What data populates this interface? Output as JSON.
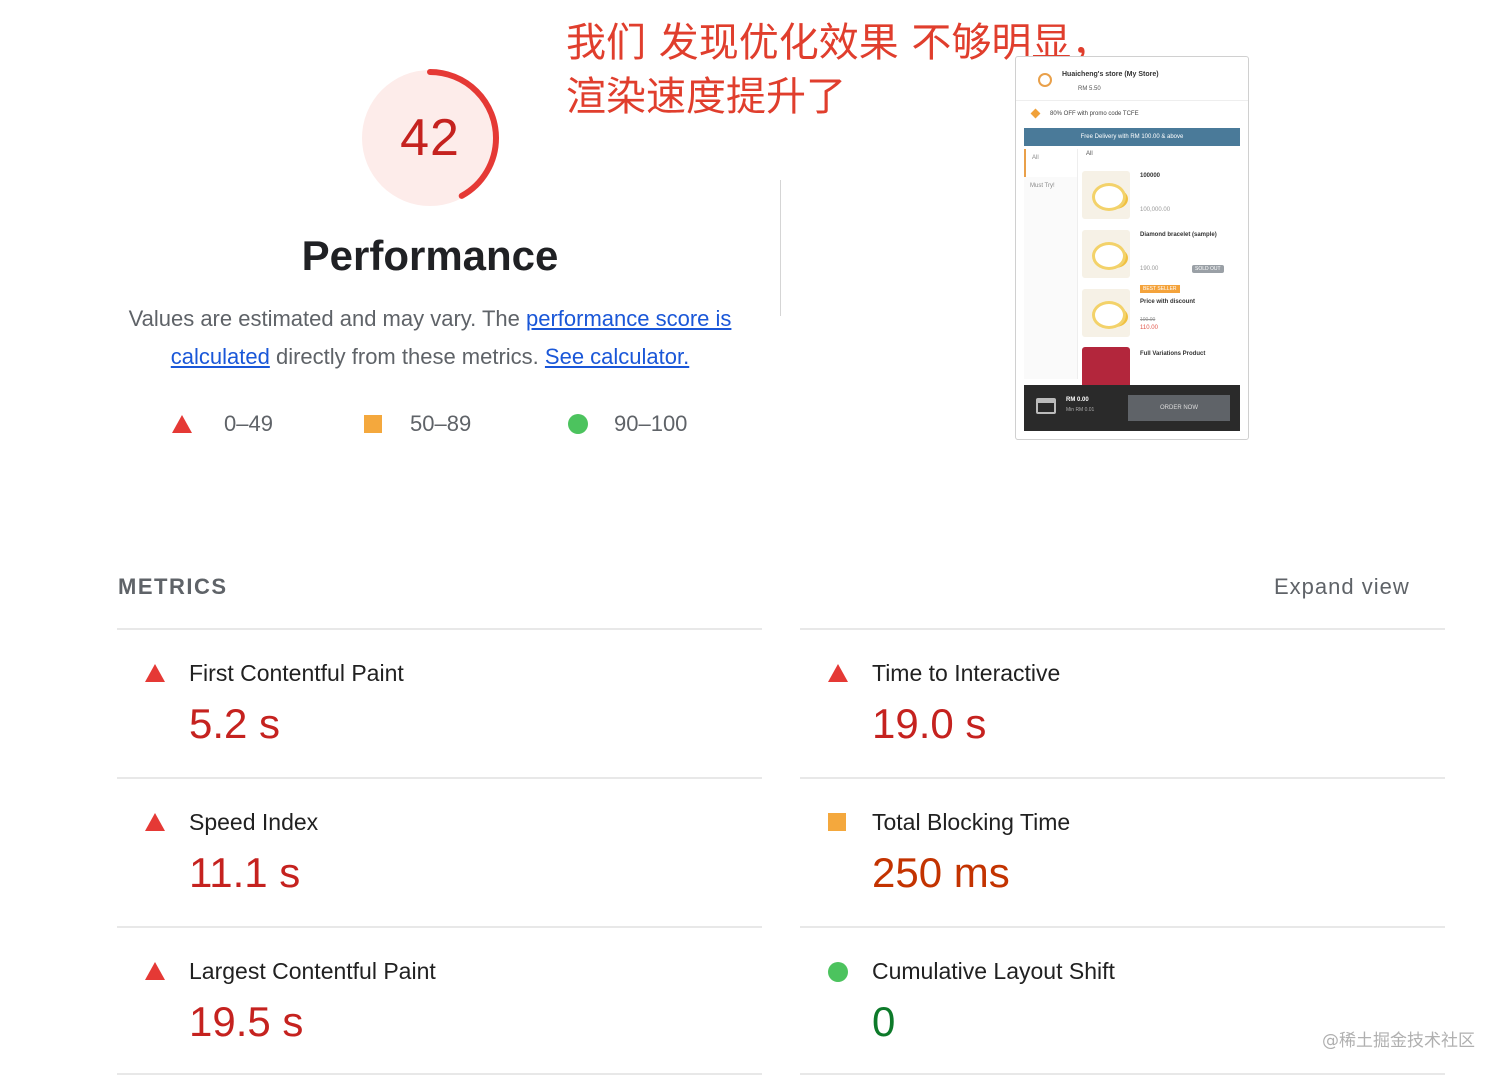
{
  "score": {
    "value": "42",
    "fraction": 0.42,
    "color": "#e53935"
  },
  "performance": {
    "title": "Performance",
    "desc_1": "Values are estimated and may vary. The ",
    "link_score": "performance score is calculated",
    "desc_2": " directly from these metrics. ",
    "link_calc": "See calculator."
  },
  "legend": [
    {
      "shape": "triangle",
      "range": "0–49",
      "color": "#e53935"
    },
    {
      "shape": "square",
      "range": "50–89",
      "color": "#f4a83d"
    },
    {
      "shape": "circle",
      "range": "90–100",
      "color": "#4cc35e"
    }
  ],
  "annotation": "我们 发现优化效果 不够明显，\n渲染速度提升了",
  "screenshot": {
    "store": "Huaicheng's store (My Store)",
    "fee": "RM 5.50",
    "promo": "80% OFF with promo code TCFE",
    "banner": "Free Delivery with RM 100.00 & above",
    "side": [
      "All",
      "Must Try!"
    ],
    "category": "All",
    "products": [
      {
        "name": "100000",
        "price": "100,000.00"
      },
      {
        "name": "Diamond bracelet (sample)",
        "price": "190.00",
        "badge": "SOLD OUT"
      },
      {
        "name": "Price with discount",
        "old": "100.00",
        "new": "110.00",
        "badge": "BEST SELLER"
      },
      {
        "name": "Full Variations Product"
      }
    ],
    "cart_total": "RM 0.00",
    "cart_min": "Min RM 0.01",
    "order_button": "ORDER NOW"
  },
  "metrics": {
    "title": "METRICS",
    "expand": "Expand view",
    "items": [
      {
        "label": "First Contentful Paint",
        "value": "5.2 s",
        "status": "fail"
      },
      {
        "label": "Time to Interactive",
        "value": "19.0 s",
        "status": "fail"
      },
      {
        "label": "Speed Index",
        "value": "11.1 s",
        "status": "fail"
      },
      {
        "label": "Total Blocking Time",
        "value": "250 ms",
        "status": "average"
      },
      {
        "label": "Largest Contentful Paint",
        "value": "19.5 s",
        "status": "fail"
      },
      {
        "label": "Cumulative Layout Shift",
        "value": "0",
        "status": "pass"
      }
    ]
  },
  "watermark": "@稀土掘金技术社区"
}
